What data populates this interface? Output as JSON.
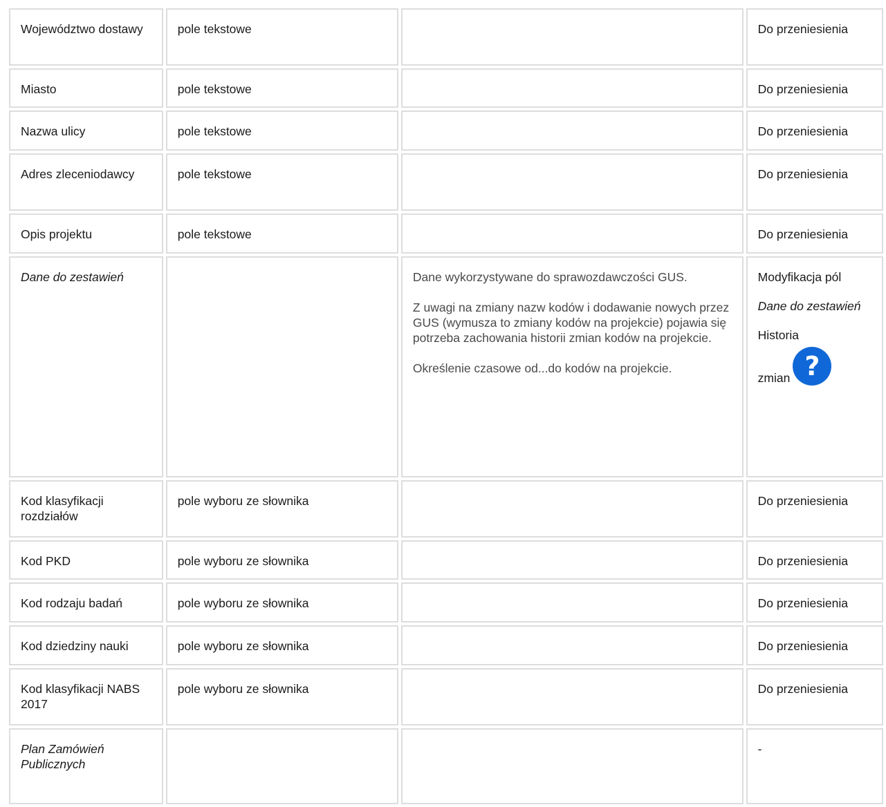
{
  "rows": [
    {
      "field": "Województwo dostawy",
      "type": "pole tekstowe",
      "status": "Do przeniesienia"
    },
    {
      "field": "Miasto",
      "type": "pole tekstowe",
      "status": "Do przeniesienia"
    },
    {
      "field": "Nazwa ulicy",
      "type": "pole tekstowe",
      "status": "Do przeniesienia"
    },
    {
      "field": "Adres zleceniodawcy",
      "type": "pole tekstowe",
      "status": "Do przeniesienia"
    },
    {
      "field": "Opis projektu",
      "type": "pole tekstowe",
      "status": "Do przeniesienia"
    },
    {
      "field": "Kod klasyfikacji rozdziałów",
      "type": "pole wyboru ze słownika",
      "status": "Do przeniesienia"
    },
    {
      "field": "Kod PKD",
      "type": "pole wyboru ze słownika",
      "status": "Do przeniesienia"
    },
    {
      "field": "Kod rodzaju badań",
      "type": "pole wyboru ze słownika",
      "status": "Do przeniesienia"
    },
    {
      "field": "Kod dziedziny nauki",
      "type": "pole wyboru ze słownika",
      "status": "Do przeniesienia"
    },
    {
      "field": "Kod klasyfikacji NABS 2017",
      "type": "pole wyboru ze słownika",
      "status": "Do przeniesienia"
    }
  ],
  "section_dane": {
    "field": "Dane do zestawień",
    "desc_1": "Dane wykorzystywane do sprawozdawczości GUS.",
    "desc_2": "Z uwagi na zmiany nazw kodów i dodawanie nowych przez GUS (wymusza to zmiany kodów na projekcie) pojawia się potrzeba zachowania historii zmian kodów na projekcie.",
    "desc_3": "Określenie czasowe od...do kodów na projekcie.",
    "status_1": "Modyfikacja pól",
    "status_2": "Dane do zestawień",
    "status_3": "Historia",
    "status_4": "zmian",
    "help_icon": "question-mark-circle-icon",
    "help_glyph": "?"
  },
  "section_plan": {
    "field": "Plan Zamówień Publicznych",
    "status": "-"
  }
}
